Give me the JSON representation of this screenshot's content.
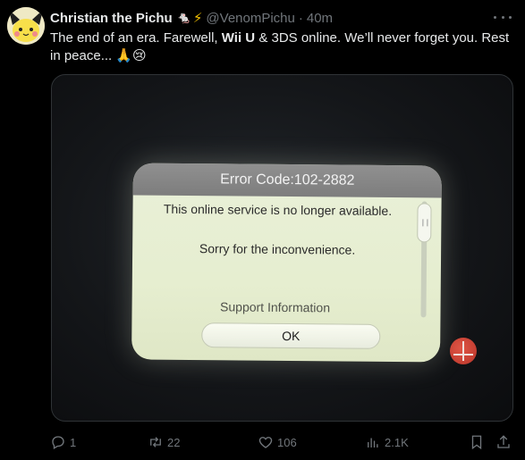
{
  "tweet": {
    "author_name": "Christian the Pichu",
    "author_emoji": "🐁",
    "bolt_glyph": "⚡",
    "handle": "@VenomPichu",
    "separator": "·",
    "time": "40m",
    "text_part1": "The end of an era. Farewell, ",
    "text_bold": "Wii U",
    "text_part2": " & 3DS online. We’ll never forget you. Rest in peace... 🙏😢"
  },
  "media": {
    "error_title": "Error Code:102-2882",
    "message_line1": "This online service is no longer available.",
    "message_line2": "Sorry for the inconvenience.",
    "support_text": "Support Information",
    "ok_label": "OK"
  },
  "actions": {
    "replies": "1",
    "reposts": "22",
    "likes": "106",
    "views": "2.1K"
  },
  "colors": {
    "background": "#000000",
    "text": "#e7e9ea",
    "muted": "#71767b",
    "bolt": "#f7c300"
  },
  "icons": [
    "avatar-pichu",
    "more-icon",
    "reply-icon",
    "repost-icon",
    "like-icon",
    "views-icon",
    "bookmark-icon",
    "share-icon"
  ]
}
